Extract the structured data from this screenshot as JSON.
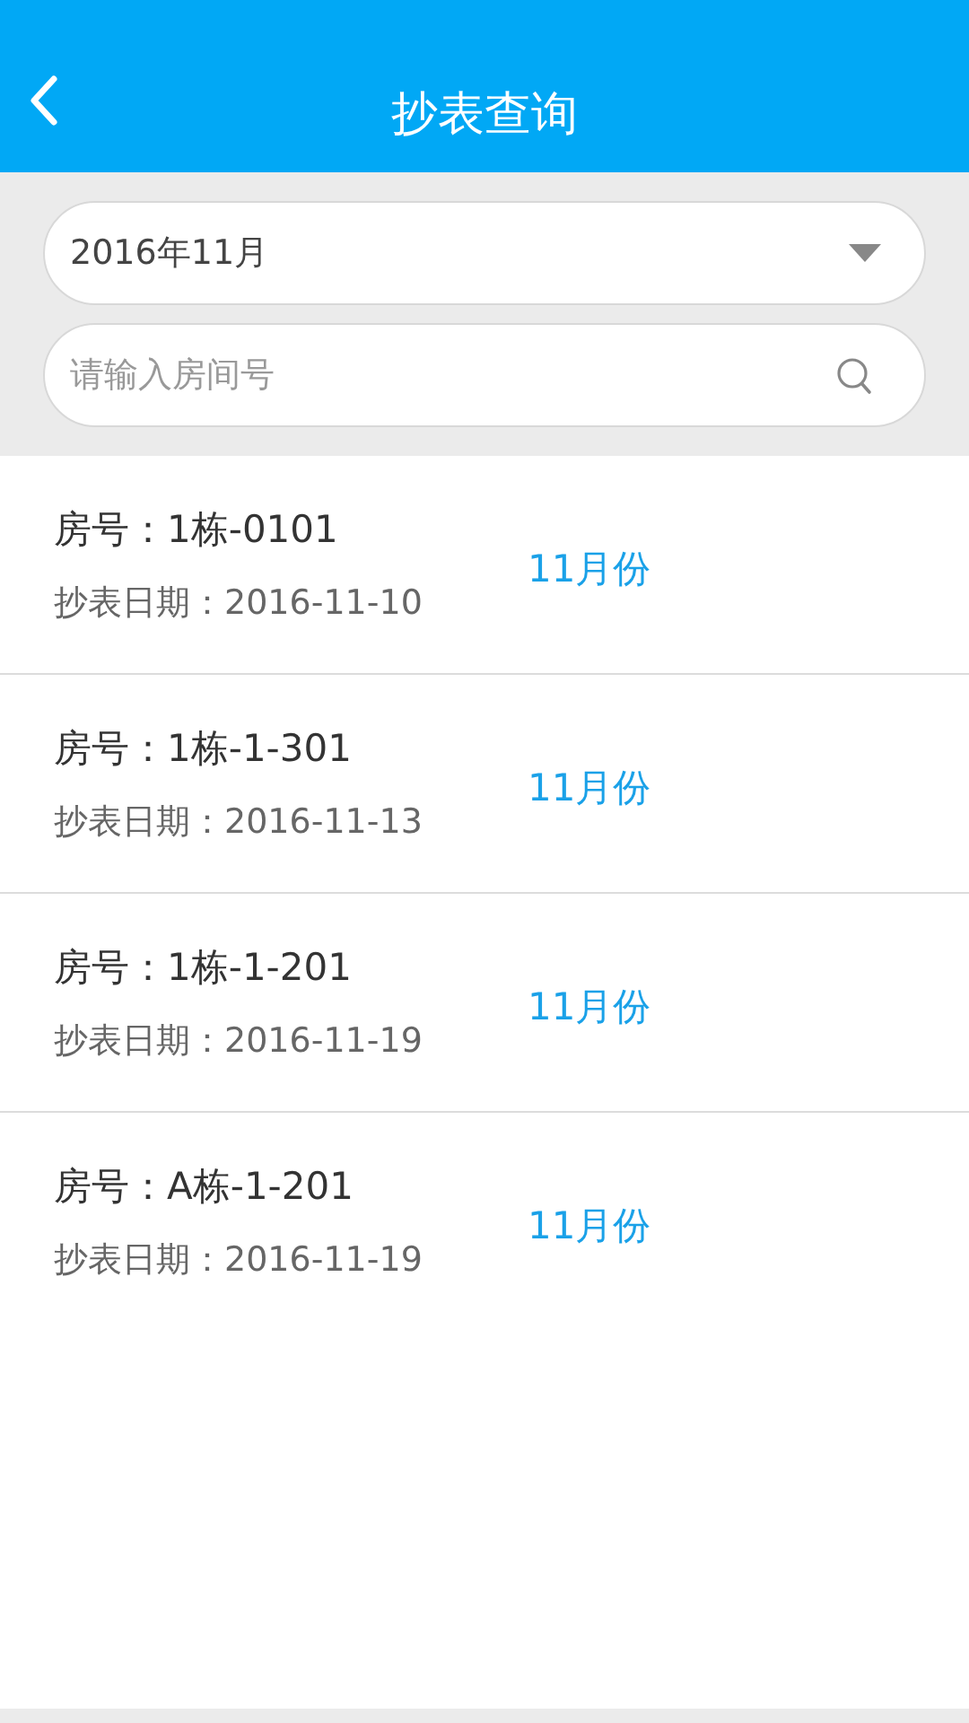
{
  "header": {
    "title": "抄表查询"
  },
  "filter": {
    "month": "2016年11月",
    "search": {
      "placeholder": "请输入房间号"
    }
  },
  "records": [
    {
      "room": "房号：1栋-0101",
      "date": "抄表日期：2016-11-10",
      "month": "11月份"
    },
    {
      "room": "房号：1栋-1-301",
      "date": "抄表日期：2016-11-13",
      "month": "11月份"
    },
    {
      "room": "房号：1栋-1-201",
      "date": "抄表日期：2016-11-19",
      "month": "11月份"
    },
    {
      "room": "房号：A栋-1-201",
      "date": "抄表日期：2016-11-19",
      "month": "11月份"
    }
  ]
}
